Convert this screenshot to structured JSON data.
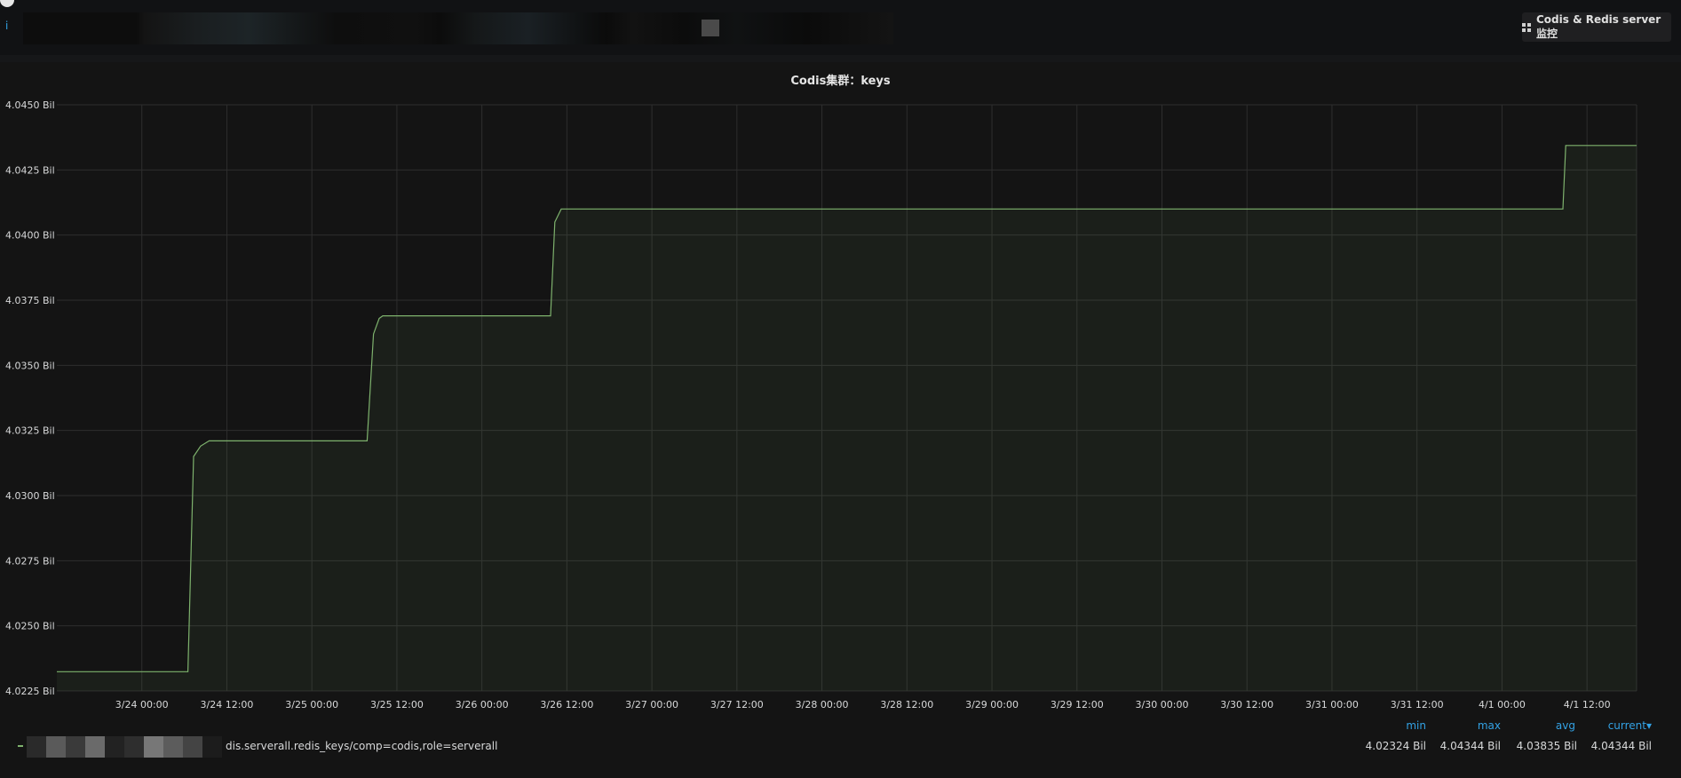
{
  "topbar": {
    "indicator": "i",
    "dashboard_button_label": "Codis & Redis server监控"
  },
  "panel": {
    "title": "Codis集群：keys"
  },
  "chart_data": {
    "type": "area",
    "title": "Codis集群：keys",
    "xlabel": "",
    "ylabel": "",
    "ylim": [
      4.0225,
      4.045
    ],
    "xlim_hours": [
      -12,
      211
    ],
    "y_ticks": [
      4.0225,
      4.025,
      4.0275,
      4.03,
      4.0325,
      4.035,
      4.0375,
      4.04,
      4.0425,
      4.045
    ],
    "y_tick_labels": [
      "4.0225 Bil",
      "4.0250 Bil",
      "4.0275 Bil",
      "4.0300 Bil",
      "4.0325 Bil",
      "4.0350 Bil",
      "4.0375 Bil",
      "4.0400 Bil",
      "4.0425 Bil",
      "4.0450 Bil"
    ],
    "x_tick_labels": [
      "3/24 00:00",
      "3/24 12:00",
      "3/25 00:00",
      "3/25 12:00",
      "3/26 00:00",
      "3/26 12:00",
      "3/27 00:00",
      "3/27 12:00",
      "3/28 00:00",
      "3/28 12:00",
      "3/29 00:00",
      "3/29 12:00",
      "3/30 00:00",
      "3/30 12:00",
      "3/31 00:00",
      "3/31 12:00",
      "4/1 00:00",
      "4/1 12:00"
    ],
    "x_ticks_hours": [
      0,
      12,
      24,
      36,
      48,
      60,
      72,
      84,
      96,
      108,
      120,
      132,
      144,
      156,
      168,
      180,
      192,
      204
    ],
    "grid": true,
    "legend_position": "bottom",
    "color": "#7eb26d",
    "series": [
      {
        "name": "dis.serverall.redis_keys/comp=codis,role=serverall",
        "x_hours": [
          -12,
          6.5,
          7.3,
          8.3,
          9.5,
          31.8,
          32.7,
          33.5,
          34.0,
          57.7,
          58.3,
          59.2,
          200.6,
          201.0,
          211
        ],
        "values": [
          4.02324,
          4.02324,
          4.0315,
          4.0319,
          4.0321,
          4.0321,
          4.0362,
          4.0368,
          4.0369,
          4.0369,
          4.0405,
          4.041,
          4.041,
          4.04344,
          4.04344
        ]
      }
    ],
    "legend": {
      "headers": [
        "min",
        "max",
        "avg",
        "current▾"
      ],
      "values": [
        "4.02324 Bil",
        "4.04344 Bil",
        "4.03835 Bil",
        "4.04344 Bil"
      ]
    }
  }
}
